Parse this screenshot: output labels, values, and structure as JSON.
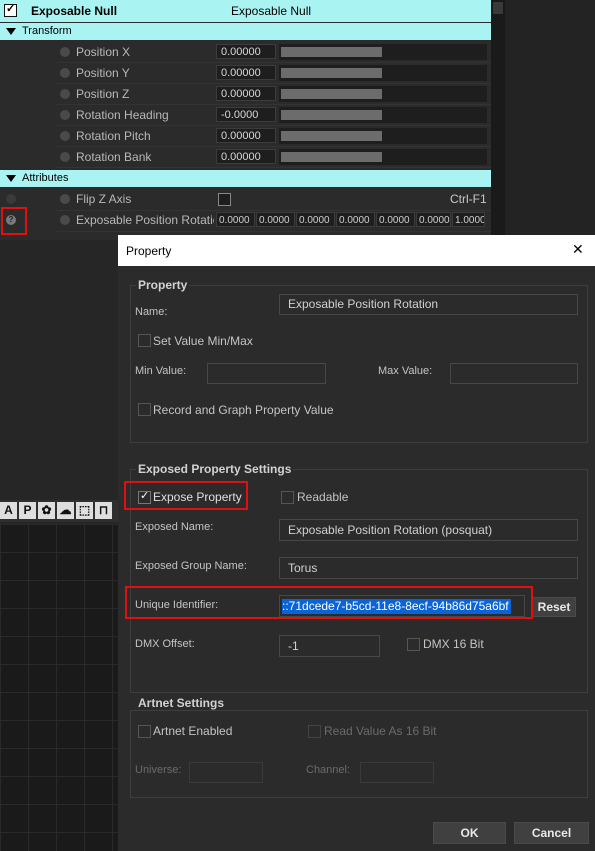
{
  "panel": {
    "header": {
      "title": "Exposable Null",
      "value": "Exposable Null"
    },
    "sections": {
      "transform": "Transform",
      "attributes": "Attributes"
    },
    "transform_rows": [
      {
        "label": "Position X",
        "value": "0.00000"
      },
      {
        "label": "Position Y",
        "value": "0.00000"
      },
      {
        "label": "Position Z",
        "value": "0.00000"
      },
      {
        "label": "Rotation Heading",
        "value": "-0.0000"
      },
      {
        "label": "Rotation Pitch",
        "value": "0.00000"
      },
      {
        "label": "Rotation Bank",
        "value": "0.00000"
      }
    ],
    "flip_z": {
      "label": "Flip Z Axis",
      "shortcut": "Ctrl-F1"
    },
    "exposable_row": {
      "label": "Exposable Position Rotatio",
      "values": [
        "0.0000",
        "0.0000",
        "0.0000",
        "0.0000",
        "0.0000",
        "0.0000",
        "1.0000"
      ]
    },
    "help_icon": "?"
  },
  "toolbar": {
    "a": "A",
    "p": "P"
  },
  "dialog": {
    "title": "Property",
    "close": "✕",
    "property_group": {
      "heading": "Property",
      "name_label": "Name:",
      "name_value": "Exposable Position Rotation",
      "set_minmax": "Set Value Min/Max",
      "min_label": "Min Value:",
      "max_label": "Max Value:",
      "record_graph": "Record and Graph Property Value"
    },
    "exposed_group": {
      "heading": "Exposed Property Settings",
      "expose_property": "Expose Property",
      "expose_checked": "✓",
      "readable": "Readable",
      "exposed_name_label": "Exposed Name:",
      "exposed_name_value": "Exposable Position Rotation (posquat)",
      "group_name_label": "Exposed Group Name:",
      "group_name_value": "Torus",
      "uid_label": "Unique Identifier:",
      "uid_value": "::71dcede7-b5cd-11e8-8ecf-94b86d75a6bf",
      "reset": "Reset",
      "dmx_offset_label": "DMX Offset:",
      "dmx_offset_value": "-1",
      "dmx16": "DMX 16 Bit"
    },
    "artnet_group": {
      "heading": "Artnet Settings",
      "enabled": "Artnet Enabled",
      "read16": "Read Value As 16 Bit",
      "universe": "Universe:",
      "channel": "Channel:"
    },
    "ok": "OK",
    "cancel": "Cancel"
  },
  "colors": {
    "header_cyan": "#a9f4f3",
    "highlight_red": "#e01010",
    "selection_blue": "#0a64d8"
  }
}
